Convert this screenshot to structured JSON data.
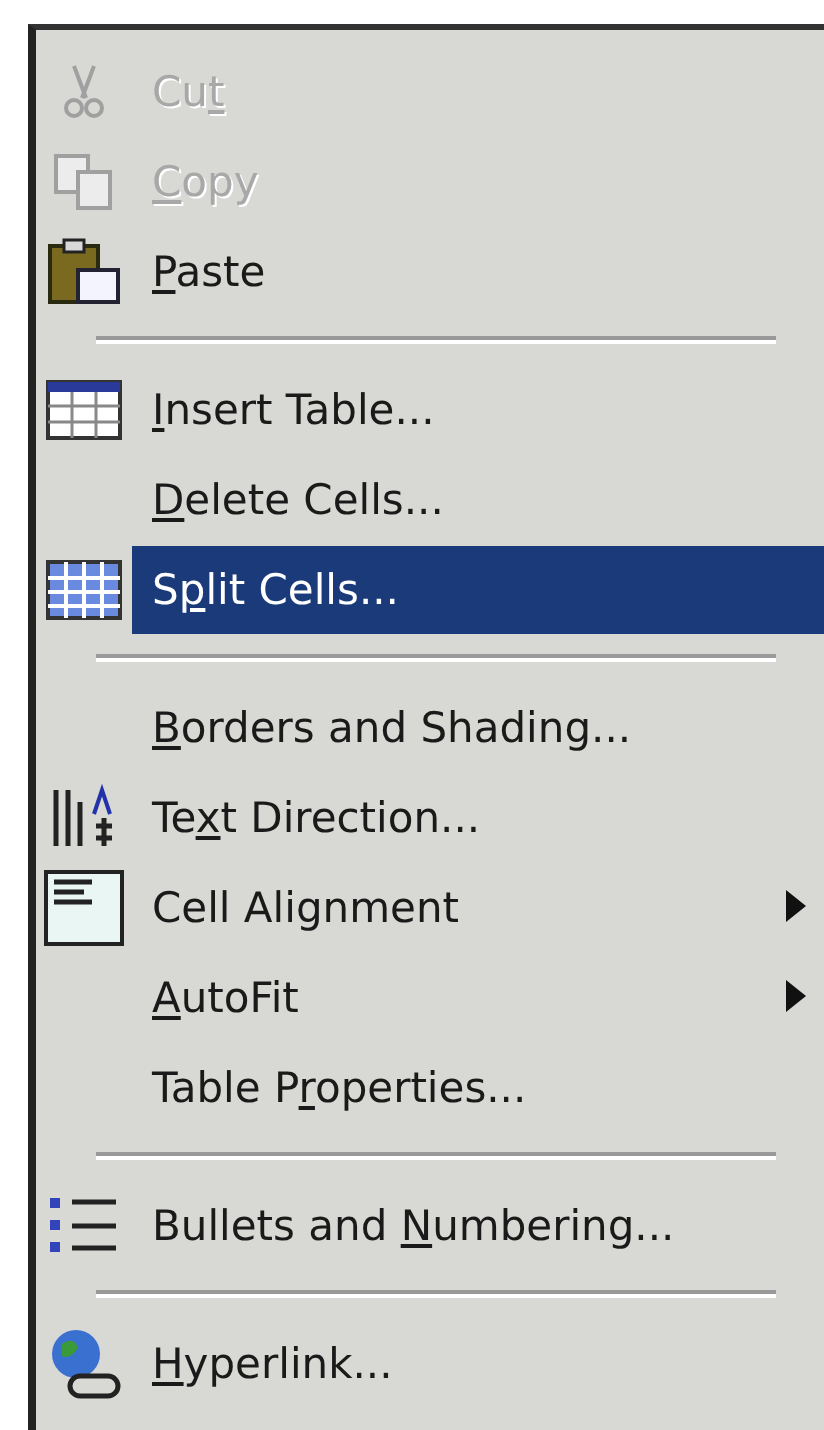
{
  "menu": {
    "items": [
      {
        "kind": "item",
        "label": [
          {
            "text": "Cu"
          },
          {
            "text": "t",
            "underline": true
          }
        ],
        "disabled": true,
        "selected": false,
        "submenu": false
      },
      {
        "kind": "item",
        "label": [
          {
            "text": "C",
            "underline": true
          },
          {
            "text": "opy"
          }
        ],
        "disabled": true,
        "selected": false,
        "submenu": false
      },
      {
        "kind": "item",
        "label": [
          {
            "text": "P",
            "underline": true
          },
          {
            "text": "aste"
          }
        ],
        "disabled": false,
        "selected": false,
        "submenu": false
      },
      {
        "kind": "separator"
      },
      {
        "kind": "item",
        "label": [
          {
            "text": "I",
            "underline": true
          },
          {
            "text": "nsert Table..."
          }
        ],
        "disabled": false,
        "selected": false,
        "submenu": false
      },
      {
        "kind": "item",
        "label": [
          {
            "text": "D",
            "underline": true
          },
          {
            "text": "elete Cells..."
          }
        ],
        "disabled": false,
        "selected": false,
        "submenu": false
      },
      {
        "kind": "item",
        "label": [
          {
            "text": "S"
          },
          {
            "text": "p",
            "underline": true
          },
          {
            "text": "lit Cells..."
          }
        ],
        "disabled": false,
        "selected": true,
        "submenu": false
      },
      {
        "kind": "separator"
      },
      {
        "kind": "item",
        "label": [
          {
            "text": "B",
            "underline": true
          },
          {
            "text": "orders and Shading..."
          }
        ],
        "disabled": false,
        "selected": false,
        "submenu": false
      },
      {
        "kind": "item",
        "label": [
          {
            "text": "Te"
          },
          {
            "text": "x",
            "underline": true
          },
          {
            "text": "t Direction..."
          }
        ],
        "disabled": false,
        "selected": false,
        "submenu": false
      },
      {
        "kind": "item",
        "label": [
          {
            "text": "Cell Alignment"
          }
        ],
        "disabled": false,
        "selected": false,
        "submenu": true
      },
      {
        "kind": "item",
        "label": [
          {
            "text": "A",
            "underline": true
          },
          {
            "text": "utoFit"
          }
        ],
        "disabled": false,
        "selected": false,
        "submenu": true
      },
      {
        "kind": "item",
        "label": [
          {
            "text": "Table P"
          },
          {
            "text": "r",
            "underline": true
          },
          {
            "text": "operties..."
          }
        ],
        "disabled": false,
        "selected": false,
        "submenu": false
      },
      {
        "kind": "separator"
      },
      {
        "kind": "item",
        "label": [
          {
            "text": "Bullets and "
          },
          {
            "text": "N",
            "underline": true
          },
          {
            "text": "umbering..."
          }
        ],
        "disabled": false,
        "selected": false,
        "submenu": false
      },
      {
        "kind": "separator"
      },
      {
        "kind": "item",
        "label": [
          {
            "text": "H",
            "underline": true
          },
          {
            "text": "yperlink..."
          }
        ],
        "disabled": false,
        "selected": false,
        "submenu": false
      }
    ]
  }
}
